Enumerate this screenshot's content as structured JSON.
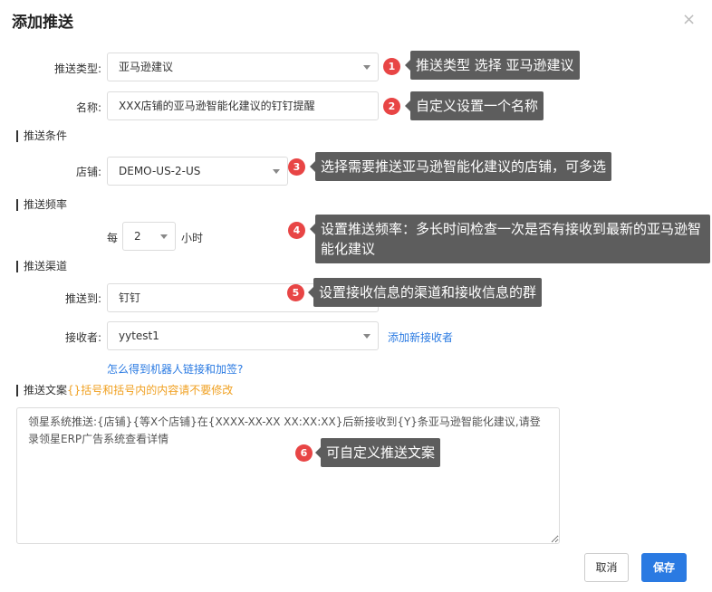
{
  "dialog": {
    "title": "添加推送",
    "close_glyph": "×"
  },
  "form": {
    "push_type": {
      "label": "推送类型:",
      "value": "亚马逊建议"
    },
    "name": {
      "label": "名称:",
      "value": "XXX店铺的亚马逊智能化建议的钉钉提醒"
    },
    "section_conditions": "推送条件",
    "store": {
      "label": "店铺:",
      "value": "DEMO-US-2-US"
    },
    "section_frequency": "推送频率",
    "frequency": {
      "prefix": "每",
      "value": "2",
      "unit": "小时"
    },
    "section_channel": "推送渠道",
    "push_to": {
      "label": "推送到:",
      "value": "钉钉"
    },
    "receiver": {
      "label": "接收者:",
      "value": "yytest1",
      "add_link": "添加新接收者"
    },
    "robot_link": "怎么得到机器人链接和加签?",
    "section_text": "推送文案",
    "section_text_hint": "{}括号和括号内的内容请不要修改",
    "text_value": "领星系统推送:{店铺}{等X个店铺}在{XXXX-XX-XX XX:XX:XX}后新接收到{Y}条亚马逊智能化建议,请登录领星ERP广告系统查看详情"
  },
  "buttons": {
    "cancel": "取消",
    "save": "保存"
  },
  "annotations": [
    {
      "num": "1",
      "text": "推送类型 选择 亚马逊建议"
    },
    {
      "num": "2",
      "text": "自定义设置一个名称"
    },
    {
      "num": "3",
      "text": "选择需要推送亚马逊智能化建议的店铺，可多选"
    },
    {
      "num": "4",
      "text": "设置推送频率：多长时间检查一次是否有接收到最新的亚马逊智能化建议"
    },
    {
      "num": "5",
      "text": "设置接收信息的渠道和接收信息的群"
    },
    {
      "num": "6",
      "text": "可自定义推送文案"
    }
  ],
  "colors": {
    "primary": "#2a7ae2",
    "badge": "#e84545",
    "tooltip": "#5d5d5d",
    "hint": "#f0a020"
  }
}
